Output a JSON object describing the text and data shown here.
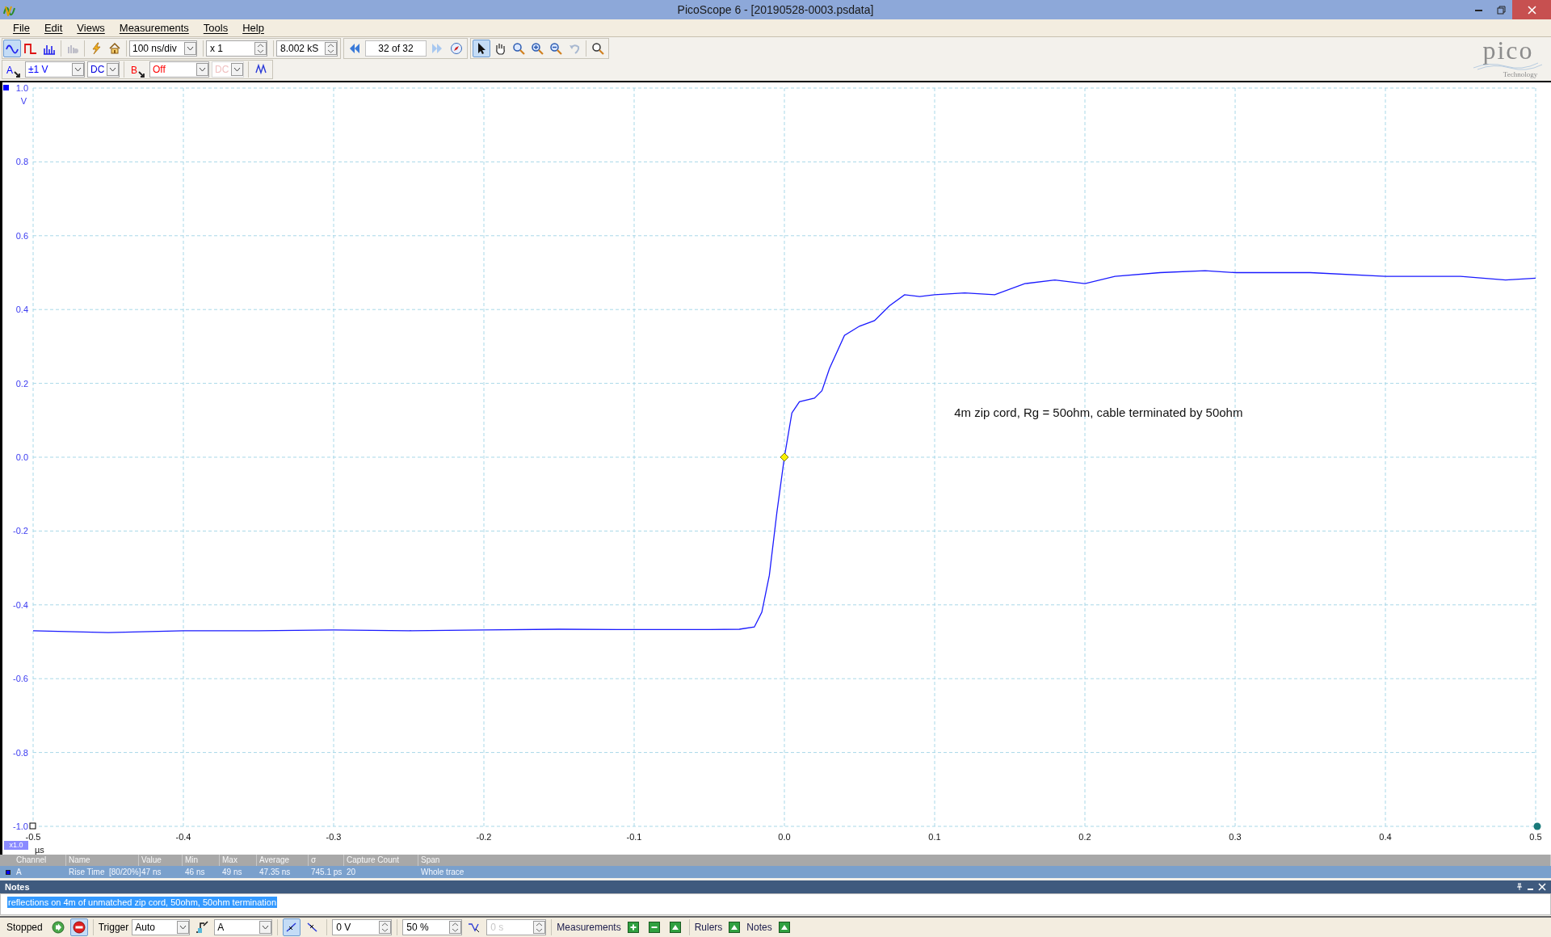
{
  "window": {
    "title": "PicoScope 6 - [20190528-0003.psdata]"
  },
  "logo": {
    "name": "pico",
    "tagline": "Technology"
  },
  "menu": [
    "File",
    "Edit",
    "Views",
    "Measurements",
    "Tools",
    "Help"
  ],
  "toolbar": {
    "view_buttons": [
      {
        "kind": "scope",
        "selected": true
      },
      {
        "kind": "persistence",
        "selected": false
      },
      {
        "kind": "spectrum",
        "selected": false
      }
    ],
    "timebase": "100 ns/div",
    "zoom": "x 1",
    "samples": "8.002 kS",
    "buffer": "32 of 32",
    "tools": [
      {
        "kind": "pointer",
        "selected": true
      },
      {
        "kind": "hand",
        "selected": false
      },
      {
        "kind": "zoom-area",
        "selected": false
      },
      {
        "kind": "zoom-in",
        "selected": false
      },
      {
        "kind": "zoom-out",
        "selected": false
      },
      {
        "kind": "undo",
        "selected": false
      }
    ]
  },
  "channels": [
    {
      "name": "A",
      "color": "#0000ff",
      "range": "±1 V",
      "coupling": "DC",
      "disabled": false
    },
    {
      "name": "B",
      "color": "#ff0000",
      "range": "Off",
      "coupling": "DC",
      "disabled": true
    }
  ],
  "scope": {
    "zoom_badge": "x1.0",
    "chart_data": {
      "type": "line",
      "xlabel": "µs",
      "ylabel": "V",
      "xlim": [
        -0.5,
        0.5
      ],
      "ylim": [
        -1.0,
        1.0
      ],
      "xticks": [
        -0.5,
        -0.4,
        -0.3,
        -0.2,
        -0.1,
        {
          "value": 0,
          "label": "0.0"
        },
        0.1,
        0.2,
        0.3,
        0.4,
        0.5
      ],
      "yticks": [
        {
          "value": 1,
          "label": "1.0"
        },
        0.8,
        0.6,
        0.4,
        0.2,
        {
          "value": 0,
          "label": "0.0"
        },
        -0.2,
        -0.4,
        -0.6,
        -0.8,
        {
          "value": -1,
          "label": "-1.0"
        }
      ],
      "x": [
        -0.5,
        -0.45,
        -0.4,
        -0.35,
        -0.3,
        -0.25,
        -0.2,
        -0.15,
        -0.1,
        -0.05,
        -0.03,
        -0.02,
        -0.015,
        -0.01,
        -0.005,
        0,
        0.005,
        0.01,
        0.02,
        0.025,
        0.03,
        0.04,
        0.05,
        0.06,
        0.07,
        0.08,
        0.09,
        0.1,
        0.12,
        0.14,
        0.16,
        0.18,
        0.2,
        0.22,
        0.25,
        0.28,
        0.3,
        0.35,
        0.4,
        0.45,
        0.48,
        0.5
      ],
      "grid": true,
      "series": [
        {
          "color": "#1a1aff",
          "values": [
            -0.47,
            -0.475,
            -0.47,
            -0.47,
            -0.468,
            -0.47,
            -0.468,
            -0.466,
            -0.467,
            -0.467,
            -0.466,
            -0.46,
            -0.42,
            -0.32,
            -0.15,
            0,
            0.12,
            0.15,
            0.16,
            0.18,
            0.24,
            0.33,
            0.355,
            0.37,
            0.41,
            0.44,
            0.435,
            0.44,
            0.445,
            0.44,
            0.47,
            0.48,
            0.47,
            0.49,
            0.5,
            0.505,
            0.5,
            0.5,
            0.49,
            0.49,
            0.48,
            0.485
          ]
        }
      ],
      "annotations": [
        "4m zip cord, Rg = 50ohm, cable terminated by 50ohm"
      ]
    }
  },
  "measurements": {
    "columns": [
      "Channel",
      "Name",
      "Value",
      "Min",
      "Max",
      "Average",
      "σ",
      "Capture Count",
      "Span"
    ],
    "rows": [
      {
        "selected": true,
        "color": "#0000ff",
        "cells": [
          "A",
          "Rise Time  [80/20%]",
          "47 ns",
          "46 ns",
          "49 ns",
          "47.35 ns",
          "745.1 ps",
          "20",
          "Whole trace"
        ]
      }
    ]
  },
  "notes": {
    "title": "Notes",
    "text": "reflections on 4m of unmatched zip cord, 50ohm, 50ohm termination"
  },
  "status_bar": {
    "state": "Stopped",
    "trigger_label": "Trigger",
    "trigger_mode": "Auto",
    "trigger_source": "A",
    "edges": [
      {
        "kind": "rising",
        "selected": true
      },
      {
        "kind": "falling",
        "selected": false
      }
    ],
    "threshold": "0 V",
    "pre_trigger": "50 %",
    "delay": "0 s",
    "measurements_label": "Measurements",
    "rulers_label": "Rulers",
    "notes_label": "Notes"
  }
}
